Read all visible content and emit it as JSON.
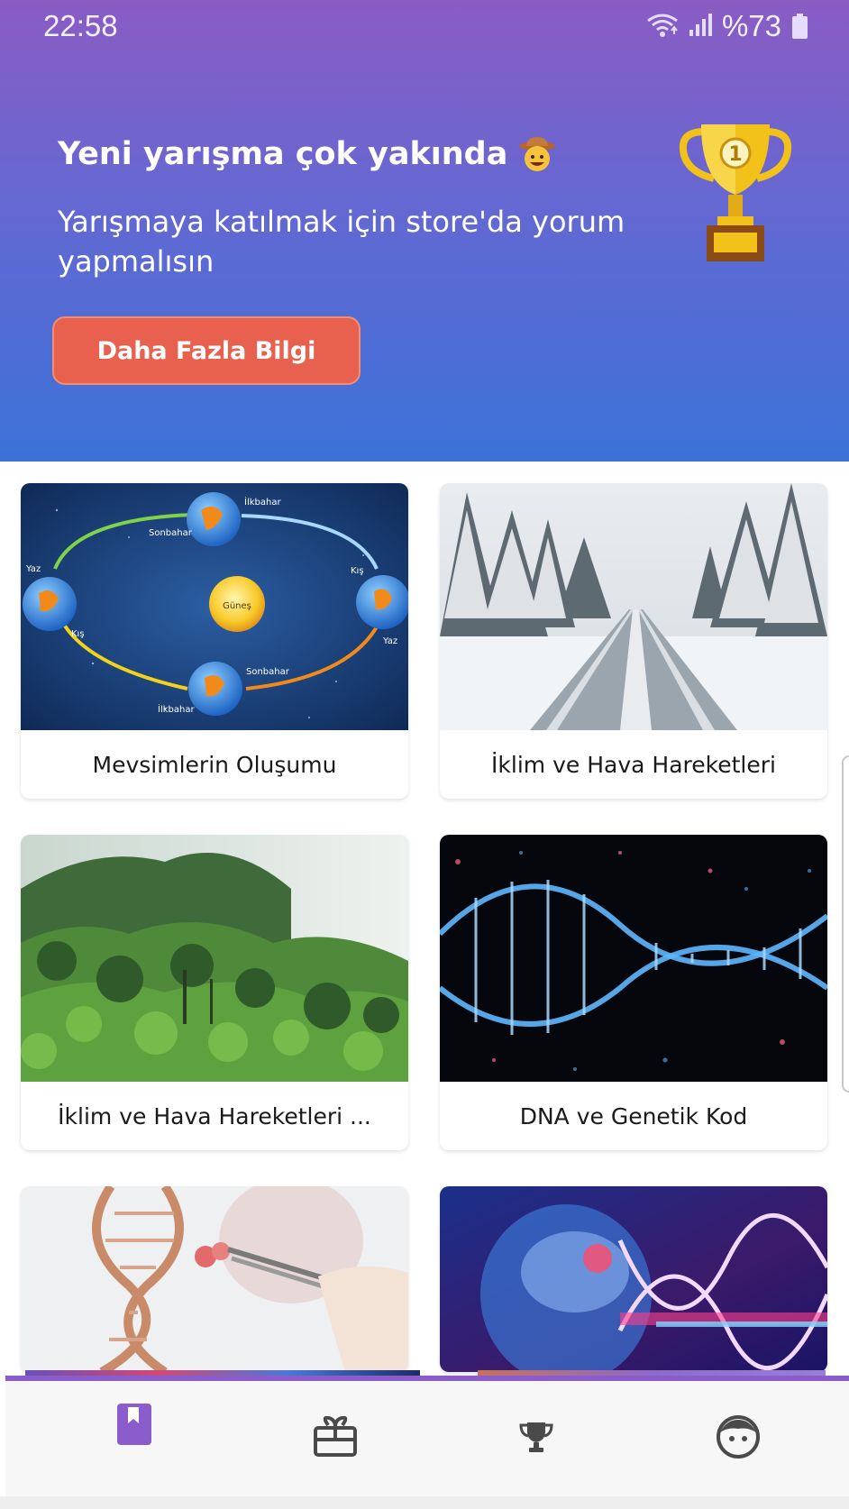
{
  "status_bar": {
    "time": "22:58",
    "battery_text": "%73",
    "icons": [
      "wifi-icon",
      "signal-icon",
      "battery-icon"
    ]
  },
  "promo": {
    "title": "Yeni yarışma çok yakında",
    "title_emoji": "cowboy-face-icon",
    "subtitle": "Yarışmaya katılmak için store'da yorum yapmalısın",
    "button_label": "Daha Fazla Bilgi",
    "trophy": "trophy-icon",
    "trophy_rank": "1"
  },
  "cards": [
    {
      "title": "Mevsimlerin Oluşumu",
      "image": "seasons-orbit-image"
    },
    {
      "title": "İklim ve Hava Hareketleri",
      "image": "snowy-road-image"
    },
    {
      "title": "İklim ve Hava Hareketleri ...",
      "image": "rainforest-image"
    },
    {
      "title": "DNA ve Genetik Kod",
      "image": "dna-helix-image"
    },
    {
      "title": "",
      "image": "dna-tweezers-image"
    },
    {
      "title": "",
      "image": "brain-dna-image"
    }
  ],
  "seasons_labels": {
    "sun": "Güneş",
    "spring_top": "İlkbahar",
    "autumn_top": "Sonbahar",
    "summer_left": "Yaz",
    "winter_left": "Kış",
    "winter_right": "Kış",
    "summer_right": "Yaz",
    "autumn_bottom": "Sonbahar",
    "spring_bottom": "İlkbahar"
  },
  "nav": {
    "items": [
      "book-icon",
      "gift-icon",
      "trophy-icon",
      "profile-icon"
    ],
    "active": 0
  },
  "colors": {
    "header_top": "#8a5cc4",
    "header_bottom": "#3b72d8",
    "button": "#e8604e",
    "nav_active": "#8b5ccc",
    "nav_inactive": "#4a4a4a"
  }
}
